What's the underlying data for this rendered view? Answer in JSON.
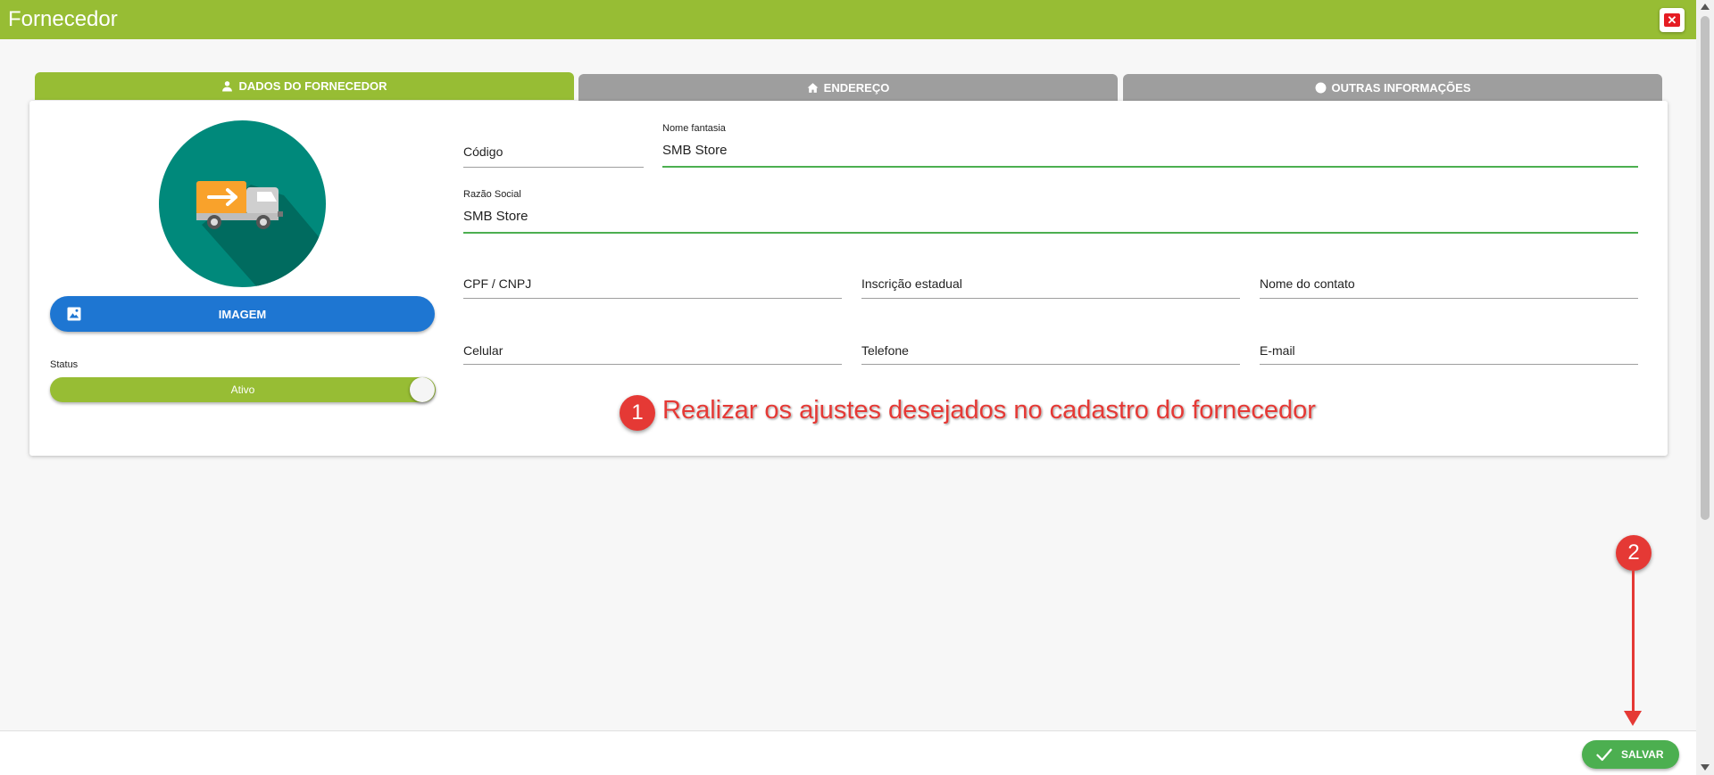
{
  "window": {
    "title": "Fornecedor",
    "close_label": "✕"
  },
  "tabs": [
    {
      "label": "DADOS DO FORNECEDOR",
      "icon": "person-icon",
      "active": true
    },
    {
      "label": "ENDEREÇO",
      "icon": "home-icon",
      "active": false
    },
    {
      "label": "OUTRAS INFORMAÇÕES",
      "icon": "info-icon",
      "active": false
    }
  ],
  "left_panel": {
    "avatar_icon": "truck-icon",
    "image_button_label": "IMAGEM",
    "status_label": "Status",
    "status_toggle_label": "Ativo"
  },
  "form": {
    "codigo": {
      "label": "Código",
      "value": ""
    },
    "nome_fantasia": {
      "label": "Nome fantasia",
      "value": "SMB Store"
    },
    "razao_social": {
      "label": "Razão Social",
      "value": "SMB Store"
    },
    "cpf_cnpj": {
      "label": "CPF / CNPJ",
      "value": ""
    },
    "inscricao_estadual": {
      "label": "Inscrição estadual",
      "value": ""
    },
    "nome_contato": {
      "label": "Nome do contato",
      "value": ""
    },
    "celular": {
      "label": "Celular",
      "value": ""
    },
    "telefone": {
      "label": "Telefone",
      "value": ""
    },
    "email": {
      "label": "E-mail",
      "value": ""
    }
  },
  "annotations": {
    "step1_number": "1",
    "step1_text": "Realizar os ajustes desejados no cadastro do fornecedor",
    "step2_number": "2"
  },
  "footer": {
    "save_label": "SALVAR"
  },
  "colors": {
    "header_green": "#97bd34",
    "tab_inactive": "#9e9e9e",
    "image_button_blue": "#1e76d2",
    "save_green": "#4caf50",
    "annotation_red": "#e53935",
    "avatar_teal": "#00897b"
  }
}
